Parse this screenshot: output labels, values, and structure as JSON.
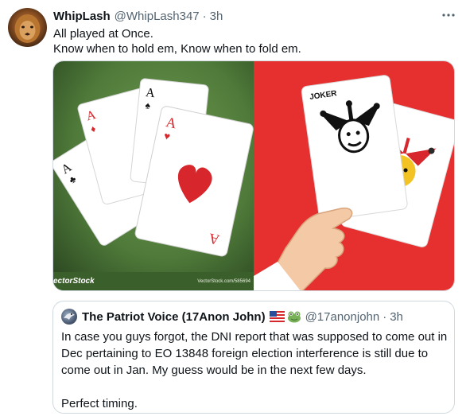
{
  "tweet": {
    "name": "WhipLash",
    "handle": "@WhipLash347",
    "separator": "·",
    "time": "3h",
    "text_line1": "All played at Once.",
    "text_line2": "Know when to hold em, Know when to fold em.",
    "more_icon": "more-horizontal-icon"
  },
  "media": {
    "left": {
      "watermark_brand": "ectorStock",
      "watermark_url": "VectorStock.com/585694",
      "background": "#4f7a3a"
    },
    "right": {
      "card_text": "JOKER",
      "background": "#e5302f"
    }
  },
  "quote": {
    "name": "The Patriot Voice (17Anon John)",
    "emoji": [
      "us-flag-icon",
      "frog-icon"
    ],
    "handle": "@17anonjohn",
    "separator": "·",
    "time": "3h",
    "text": "In case you guys forgot, the DNI report that was supposed to come out in Dec pertaining to EO 13848 foreign election interference is still due to come out in Jan. My guess would be in the next few days.\n\nPerfect timing."
  },
  "colors": {
    "secondary_text": "#536471",
    "border": "#cfd9de",
    "heart_red": "#d7262c",
    "felt_green": "#4f7a3a",
    "joker_red": "#e5302f"
  }
}
